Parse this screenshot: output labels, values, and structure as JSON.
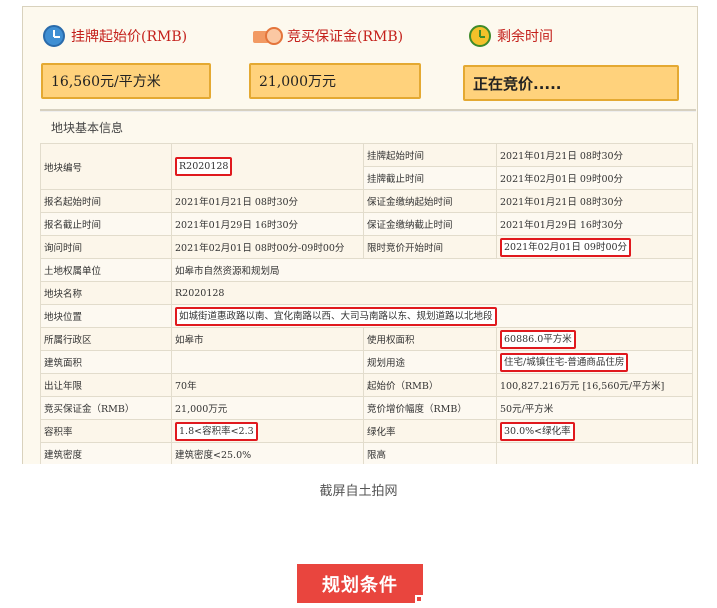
{
  "stats": {
    "start_price": {
      "label": "挂牌起始价(RMB)",
      "value": "16,560元/平方米",
      "icon": "price-clock-icon"
    },
    "deposit": {
      "label": "竞买保证金(RMB)",
      "value": "21,000万元",
      "icon": "money-icon"
    },
    "remaining": {
      "label": "剩余时间",
      "value": "正在竞价.....",
      "icon": "alarm-clock-icon"
    }
  },
  "section_title": "地块基本信息",
  "table": {
    "r1": {
      "k1": "地块编号",
      "v1": "R2020128",
      "k2a": "挂牌起始时间",
      "v2a": "2021年01月21日 08时30分",
      "k2b": "挂牌截止时间",
      "v2b": "2021年02月01日 09时00分"
    },
    "r2": {
      "k1": "报名起始时间",
      "v1": "2021年01月21日 08时30分",
      "k2": "保证金缴纳起始时间",
      "v2": "2021年01月21日 08时30分"
    },
    "r3": {
      "k1": "报名截止时间",
      "v1": "2021年01月29日 16时30分",
      "k2": "保证金缴纳截止时间",
      "v2": "2021年01月29日 16时30分"
    },
    "r4": {
      "k1": "询问时间",
      "v1": "2021年02月01日 08时00分-09时00分",
      "k2": "限时竞价开始时间",
      "v2": "2021年02月01日 09时00分"
    },
    "r5": {
      "k1": "土地权属单位",
      "v1": "如皋市自然资源和规划局"
    },
    "r6": {
      "k1": "地块名称",
      "v1": "R2020128"
    },
    "r7": {
      "k1": "地块位置",
      "v1": "如城街道惠政路以南、宜化南路以西、大司马南路以东、规划道路以北地段"
    },
    "r8": {
      "k1": "所属行政区",
      "v1": "如皋市",
      "k2": "使用权面积",
      "v2": "60886.0平方米"
    },
    "r9": {
      "k1": "建筑面积",
      "v1": "",
      "k2": "规划用途",
      "v2": "住宅/城镇住宅-普通商品住房"
    },
    "r10": {
      "k1": "出让年限",
      "v1": "70年",
      "k2": "起始价（RMB）",
      "v2": "100,827.216万元 [16,560元/平方米]"
    },
    "r11": {
      "k1": "竞买保证金（RMB）",
      "v1": "21,000万元",
      "k2": "竞价增价幅度（RMB）",
      "v2": "50元/平方米"
    },
    "r12": {
      "k1": "容积率",
      "v1": "1.8<容积率<2.3",
      "k2": "绿化率",
      "v2": "30.0%<绿化率"
    },
    "r13": {
      "k1": "建筑密度",
      "v1": "建筑密度<25.0%",
      "k2": "限高",
      "v2": ""
    }
  },
  "caption": "截屏自土拍网",
  "heading_block": "规划条件"
}
